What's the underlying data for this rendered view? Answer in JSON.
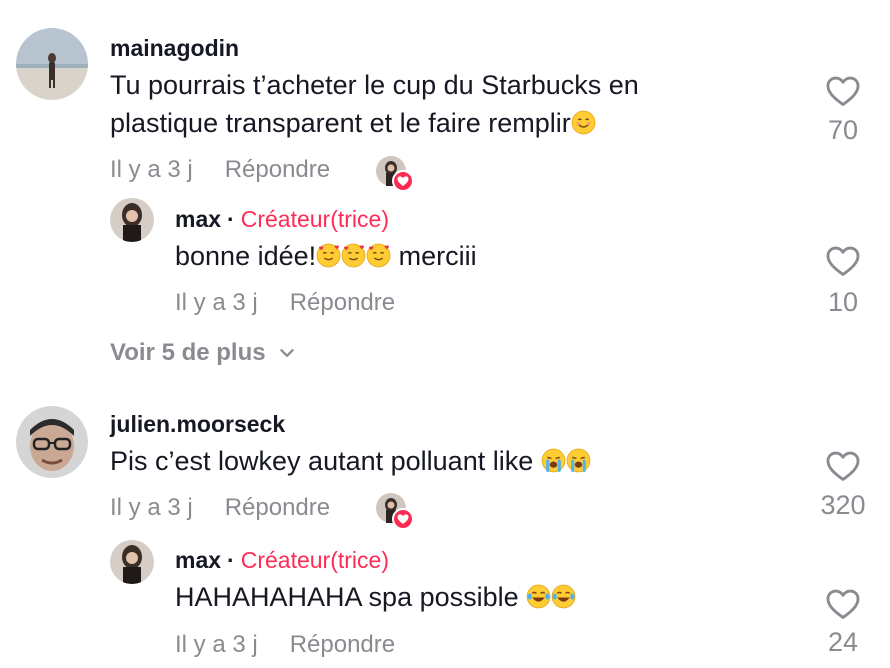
{
  "comments": [
    {
      "username": "mainagodin",
      "text_line1": "Tu pourrais t’acheter le cup du Starbucks en",
      "text_line2": "plastique transparent et le faire remplir",
      "emoji": "smiling-face-icon",
      "time": "Il y a 3 j",
      "reply": "Répondre",
      "likes": "70",
      "creator_liked": true,
      "replies": [
        {
          "username": "max",
          "separator": "·",
          "badge": "Créateur(trice)",
          "text": "bonne idée!",
          "emoji_after": "smiling-face-with-hearts-icon",
          "text_after": " merciii",
          "time": "Il y a 3 j",
          "reply": "Répondre",
          "likes": "10"
        }
      ],
      "view_more": "Voir 5 de plus"
    },
    {
      "username": "julien.moorseck",
      "text": "Pis c’est lowkey autant polluant like ",
      "emoji": "loudly-crying-face-icon",
      "time": "Il y a 3 j",
      "reply": "Répondre",
      "likes": "320",
      "creator_liked": true,
      "replies": [
        {
          "username": "max",
          "separator": "·",
          "badge": "Créateur(trice)",
          "text": "HAHAHAHAHA spa possible ",
          "emoji": "tears-of-joy-icon",
          "time": "Il y a 3 j",
          "reply": "Répondre",
          "likes": "24"
        }
      ]
    }
  ],
  "colors": {
    "accent": "#fe2c55",
    "text": "#161823",
    "secondary": "#8a8b91",
    "heart_outline": "#8a8b91"
  }
}
